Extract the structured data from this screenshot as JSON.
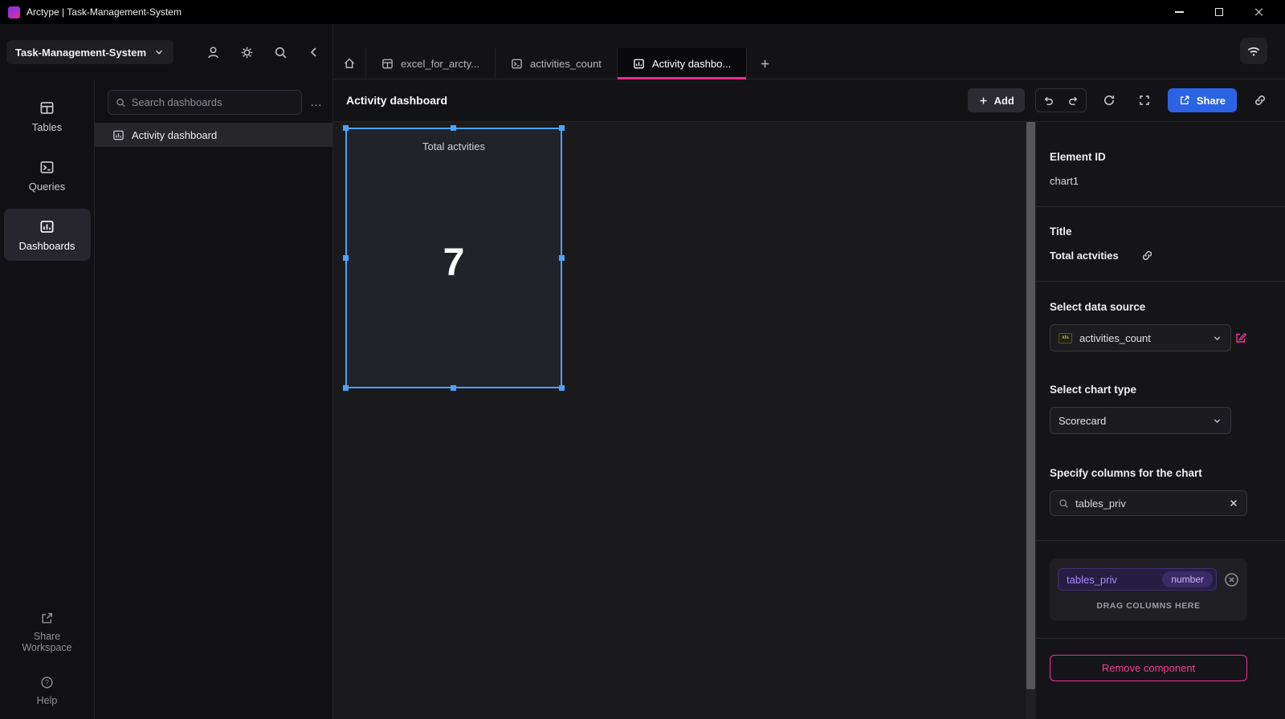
{
  "titlebar": {
    "title": "Arctype | Task-Management-System"
  },
  "workspace": {
    "name": "Task-Management-System"
  },
  "nav": {
    "items": [
      {
        "label": "Tables"
      },
      {
        "label": "Queries"
      },
      {
        "label": "Dashboards"
      }
    ],
    "footer": [
      {
        "label": "Share Workspace"
      },
      {
        "label": "Help"
      }
    ]
  },
  "dashboards_panel": {
    "search_placeholder": "Search dashboards",
    "overflow_menu": "…",
    "items": [
      {
        "label": "Activity dashboard"
      }
    ]
  },
  "tabs": {
    "items": [
      {
        "label": "excel_for_arcty..."
      },
      {
        "label": "activities_count"
      },
      {
        "label": "Activity dashbo..."
      }
    ]
  },
  "toolbar": {
    "title": "Activity dashboard",
    "add": "Add",
    "share": "Share"
  },
  "card": {
    "title": "Total actvities",
    "value": "7"
  },
  "inspector": {
    "element_id_label": "Element ID",
    "element_id_value": "chart1",
    "title_label": "Title",
    "title_value": "Total actvities",
    "data_source_label": "Select data source",
    "data_source_value": "activities_count",
    "data_source_file_badge": "xls",
    "chart_type_label": "Select chart type",
    "chart_type_value": "Scorecard",
    "columns_label": "Specify columns for the chart",
    "columns_search_value": "tables_priv",
    "chip_name": "tables_priv",
    "chip_type": "number",
    "drop_hint": "DRAG COLUMNS HERE",
    "remove_button": "Remove component"
  },
  "colors": {
    "accent_pink": "#ec2c91",
    "share_blue": "#2c63e4",
    "selection_blue": "#4aa3ff"
  }
}
